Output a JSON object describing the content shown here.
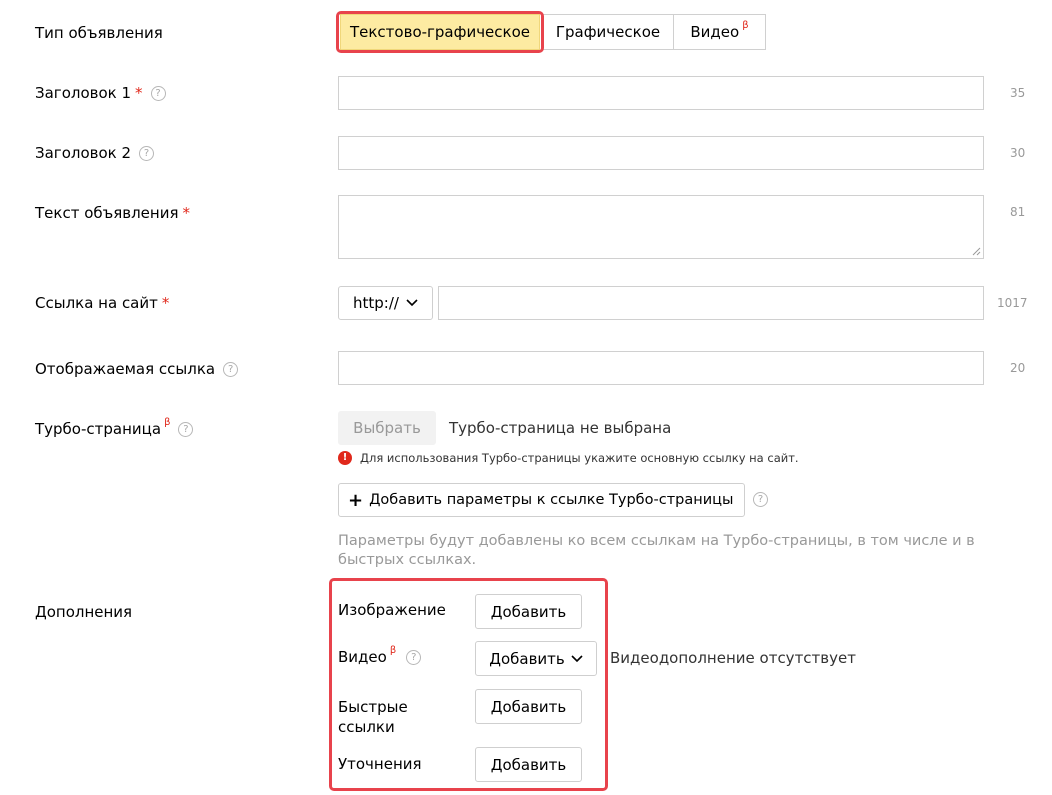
{
  "ad_type": {
    "label": "Тип объявления",
    "options": [
      "Текстово-графическое",
      "Графическое",
      "Видео"
    ],
    "selected": "Текстово-графическое",
    "beta_mark": "β"
  },
  "headline1": {
    "label": "Заголовок 1",
    "required_mark": "*",
    "help": "?",
    "value": "",
    "counter": "35"
  },
  "headline2": {
    "label": "Заголовок 2",
    "help": "?",
    "value": "",
    "counter": "30"
  },
  "ad_text": {
    "label": "Текст объявления",
    "required_mark": "*",
    "value": "",
    "counter": "81"
  },
  "site_link": {
    "label": "Ссылка на сайт",
    "required_mark": "*",
    "protocol": "http://",
    "value": "",
    "counter": "1017"
  },
  "display_link": {
    "label": "Отображаемая ссылка",
    "help": "?",
    "value": "",
    "counter": "20"
  },
  "turbo": {
    "label": "Турбо-страница",
    "beta_mark": "β",
    "help": "?",
    "select_button": "Выбрать",
    "status": "Турбо-страница не выбрана",
    "warning_icon": "!",
    "warning": "Для использования Турбо-страницы укажите основную ссылку на сайт.",
    "add_params_button": "Добавить параметры к ссылке Турбо-страницы",
    "plus": "+",
    "params_note": "Параметры будут добавлены ко всем ссылкам на Турбо-страницы, в том числе и в быстрых ссылках."
  },
  "extras": {
    "label": "Дополнения",
    "image": {
      "label": "Изображение",
      "button": "Добавить"
    },
    "video": {
      "label": "Видео",
      "beta_mark": "β",
      "help": "?",
      "button": "Добавить",
      "status": "Видеодополнение отсутствует"
    },
    "quicklinks": {
      "label_line1": "Быстрые",
      "label_line2": "ссылки",
      "button": "Добавить"
    },
    "callouts": {
      "label": "Уточнения",
      "button": "Добавить"
    }
  },
  "colors": {
    "selected_segment": "#fdeba2",
    "highlight": "#e8434c",
    "required": "#e0281b",
    "muted": "#999999"
  }
}
